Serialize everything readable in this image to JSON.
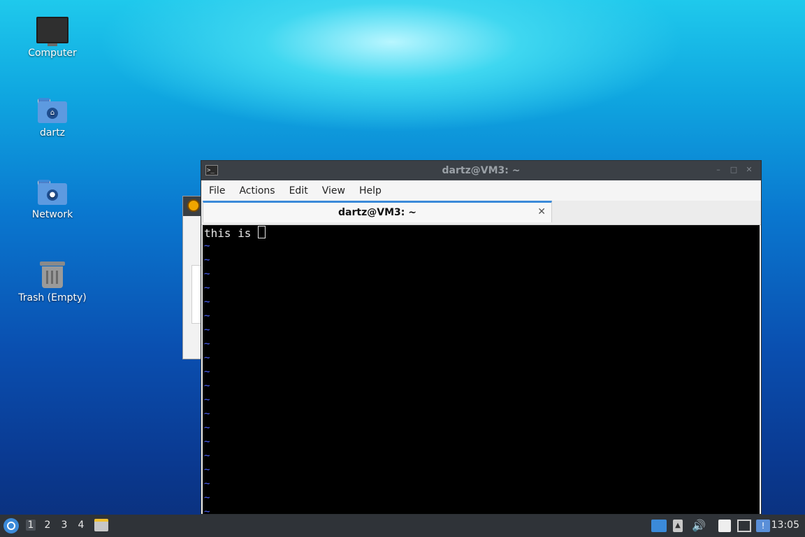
{
  "desktop": {
    "icons": [
      {
        "label": "Computer",
        "icon": "computer-icon"
      },
      {
        "label": "dartz",
        "icon": "home-folder-icon"
      },
      {
        "label": "Network",
        "icon": "network-folder-icon"
      },
      {
        "label": "Trash (Empty)",
        "icon": "trash-icon"
      }
    ]
  },
  "terminal_window": {
    "title": "dartz@VM3: ~",
    "menu": [
      "File",
      "Actions",
      "Edit",
      "View",
      "Help"
    ],
    "tab_label": "dartz@VM3: ~",
    "content_line": "this is ",
    "tilde": "~"
  },
  "taskbar": {
    "workspaces": [
      "1",
      "2",
      "3",
      "4"
    ],
    "active_workspace": "1",
    "clock": "13:05",
    "tray_icons": [
      "show-desktop-icon",
      "tray-arrow-icon",
      "volume-icon",
      "clipboard-icon",
      "network-icon",
      "update-notifier-icon"
    ]
  },
  "colors": {
    "accent": "#3b8ad9",
    "vim_tilde": "#4c63ff",
    "titlebar": "#3b4046"
  }
}
